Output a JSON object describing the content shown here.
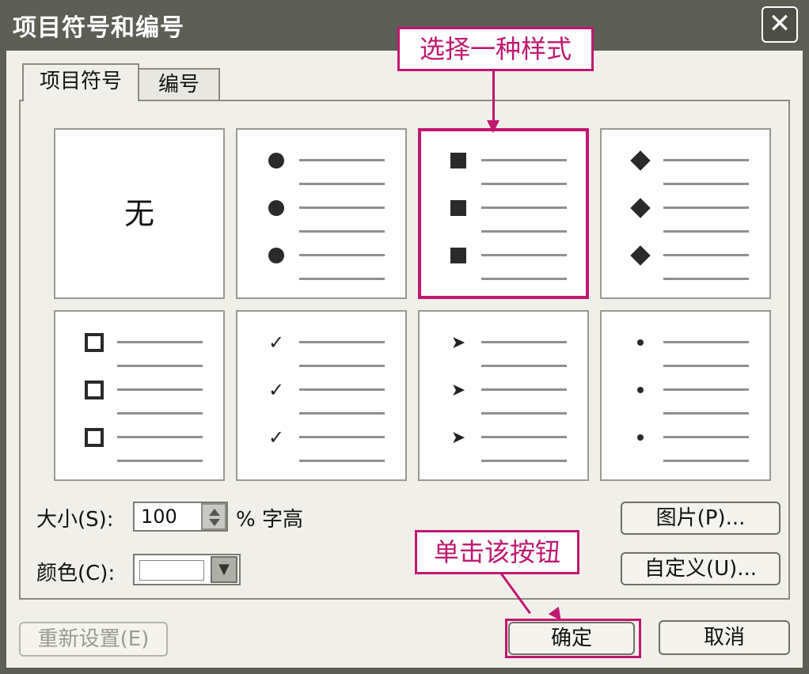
{
  "window": {
    "title": "项目符号和编号",
    "close_label": "✕"
  },
  "tabs": [
    {
      "label": "项目符号",
      "active": true
    },
    {
      "label": "编号",
      "active": false
    }
  ],
  "bullet_styles": [
    {
      "name": "none",
      "text": "无"
    },
    {
      "name": "filled-circle",
      "icon": "filled-circle-icon"
    },
    {
      "name": "filled-square",
      "icon": "filled-square-icon",
      "selected": true
    },
    {
      "name": "filled-diamond",
      "icon": "filled-diamond-icon"
    },
    {
      "name": "hollow-square",
      "icon": "hollow-square-icon"
    },
    {
      "name": "checkmark",
      "icon": "checkmark-icon",
      "glyph": "✓"
    },
    {
      "name": "arrowhead",
      "icon": "arrowhead-icon",
      "glyph": "➤"
    },
    {
      "name": "small-dot",
      "icon": "small-dot-icon"
    }
  ],
  "size": {
    "label": "大小(S):",
    "value": "100",
    "suffix": "% 字高"
  },
  "color": {
    "label": "颜色(C):",
    "value": ""
  },
  "buttons": {
    "picture": "图片(P)...",
    "customize": "自定义(U)...",
    "reset": "重新设置(E)",
    "ok": "确定",
    "cancel": "取消"
  },
  "annotations": {
    "choose_style": "选择一种样式",
    "click_button": "单击该按钮"
  },
  "colors": {
    "accent": "#c0176f",
    "title_bar": "#5d5e55",
    "dialog_bg": "#f0efea"
  }
}
